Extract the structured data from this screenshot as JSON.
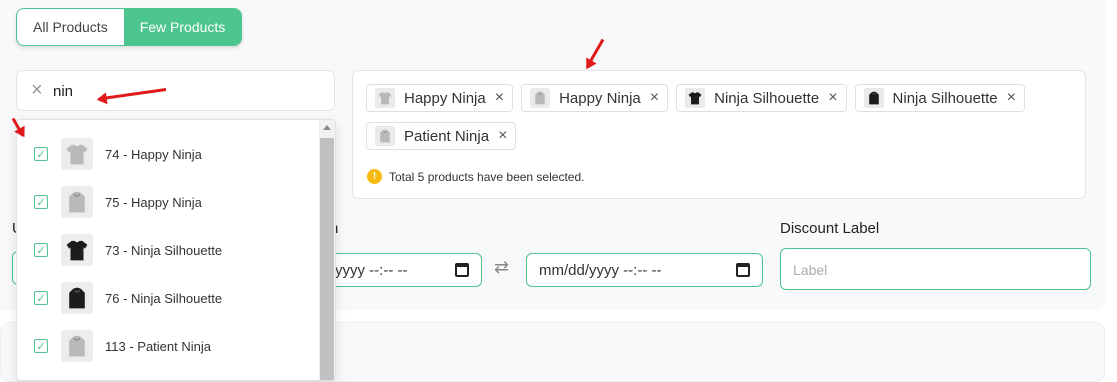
{
  "tabs": [
    {
      "label": "All Products",
      "active": false
    },
    {
      "label": "Few Products",
      "active": true
    }
  ],
  "search": {
    "value": "nin",
    "clear_icon": "close-icon"
  },
  "dropdown": {
    "items": [
      {
        "label": "74 - Happy Ninja",
        "checked": true,
        "thumb": "tshirt-grey"
      },
      {
        "label": "75 - Happy Ninja",
        "checked": true,
        "thumb": "hoodie-grey"
      },
      {
        "label": "73 - Ninja Silhouette",
        "checked": true,
        "thumb": "tshirt-black"
      },
      {
        "label": "76 - Ninja Silhouette",
        "checked": true,
        "thumb": "hoodie-black"
      },
      {
        "label": "113 - Patient Ninja",
        "checked": true,
        "thumb": "hoodie-grey"
      }
    ]
  },
  "selected": {
    "tags": [
      {
        "label": "Happy Ninja",
        "thumb": "tshirt-grey"
      },
      {
        "label": "Happy Ninja",
        "thumb": "hoodie-grey"
      },
      {
        "label": "Ninja Silhouette",
        "thumb": "tshirt-black"
      },
      {
        "label": "Ninja Silhouette",
        "thumb": "hoodie-black"
      },
      {
        "label": "Patient Ninja",
        "thumb": "hoodie-grey"
      }
    ],
    "info": "Total 5 products have been selected."
  },
  "form": {
    "partial_left_label": "U",
    "partial_mid_label": "n",
    "date_from_value": "yyyy --:-- --",
    "date_to_value": "mm/dd/yyyy --:-- --",
    "discount_label": "Discount Label",
    "discount_placeholder": "Label"
  },
  "colors": {
    "accent": "#4cc58e",
    "warning": "#f5b90f",
    "annotation": "#e0191b"
  }
}
